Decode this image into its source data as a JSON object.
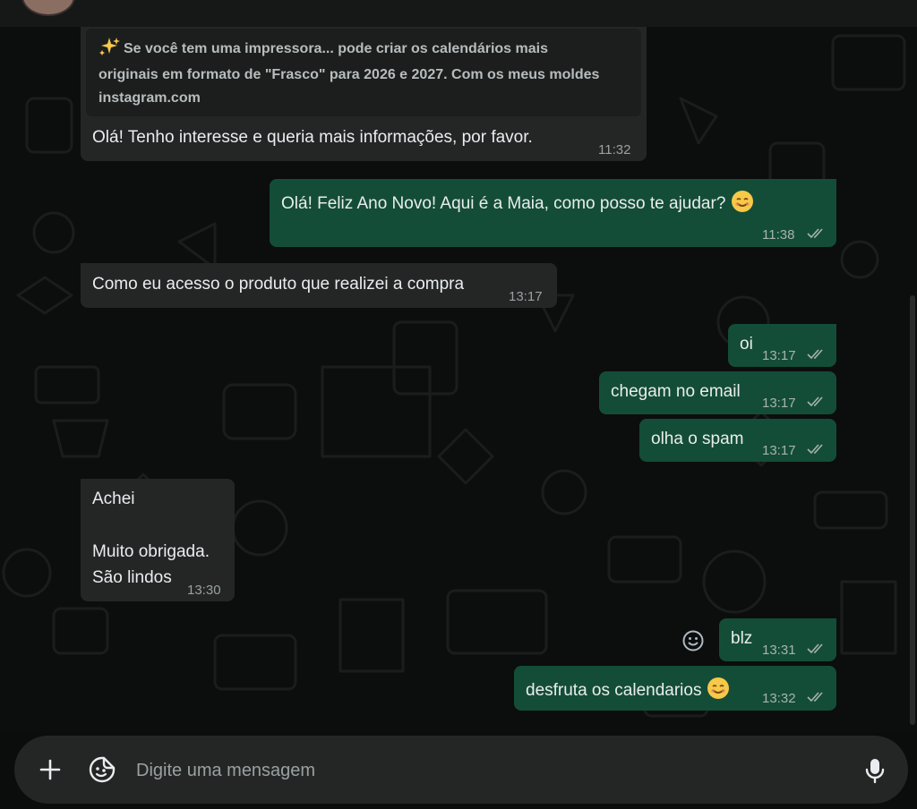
{
  "quote": {
    "line1": "Se você tem uma impressora... pode criar os calendários mais",
    "line2": "originais em formato de \"Frasco\" para 2026 e 2027. Com os meus moldes",
    "line3": "instagram.com"
  },
  "messages": [
    {
      "text": "Olá! Tenho interesse e queria mais informações, por favor.",
      "time": "11:32"
    },
    {
      "text": "Olá! Feliz Ano Novo! Aqui é a Maia, como posso te ajudar?",
      "time": "11:38"
    },
    {
      "text": "Como eu acesso o produto que realizei a compra",
      "time": "13:17"
    },
    {
      "text": "oi",
      "time": "13:17"
    },
    {
      "text": "chegam no email",
      "time": "13:17"
    },
    {
      "text": "olha o spam",
      "time": "13:17"
    },
    {
      "line1": "Achei",
      "line2": "Muito obrigada.",
      "line3": "São lindos",
      "time": "13:30"
    },
    {
      "text": "blz",
      "time": "13:31"
    },
    {
      "text": "desfruta os calendarios",
      "time": "13:32"
    }
  ],
  "composer": {
    "placeholder": "Digite uma mensagem"
  },
  "colors": {
    "incoming": "#242626",
    "outgoing": "#144d37",
    "read_ticks": "#a6b3b0"
  }
}
